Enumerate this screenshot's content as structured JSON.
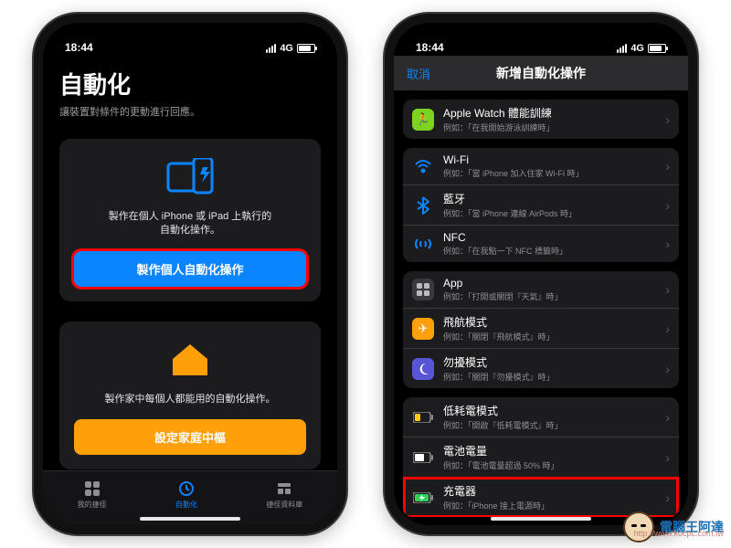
{
  "status": {
    "time": "18:44",
    "carrier": "4G"
  },
  "left": {
    "title": "自動化",
    "subtitle": "讓裝置對條件的更動進行回應。",
    "card1": {
      "desc_line1": "製作在個人 iPhone 或 iPad 上執行的",
      "desc_line2": "自動化操作。",
      "button": "製作個人自動化操作"
    },
    "card2": {
      "desc": "製作家中每個人都能用的自動化操作。",
      "button": "設定家庭中樞"
    },
    "tabs": {
      "t1": "我的捷徑",
      "t2": "自動化",
      "t3": "捷徑資料庫"
    }
  },
  "right": {
    "cancel": "取消",
    "nav_title": "新增自動化操作",
    "rows": {
      "watch": {
        "title": "Apple Watch 體能訓練",
        "sub": "例如：「在我開始游泳訓練時」"
      },
      "wifi": {
        "title": "Wi-Fi",
        "sub": "例如：「當 iPhone 加入住家 Wi-Fi 時」"
      },
      "bt": {
        "title": "藍牙",
        "sub": "例如：「當 iPhone 連線 AirPods 時」"
      },
      "nfc": {
        "title": "NFC",
        "sub": "例如：「在我點一下 NFC 標籤時」"
      },
      "app": {
        "title": "App",
        "sub": "例如：「打開或關閉『天氣』時」"
      },
      "air": {
        "title": "飛航模式",
        "sub": "例如：「關閉『飛航模式』時」"
      },
      "dnd": {
        "title": "勿擾模式",
        "sub": "例如：「關閉『勿擾模式』時」"
      },
      "low": {
        "title": "低耗電模式",
        "sub": "例如：「開啟『低耗電模式』時」"
      },
      "level": {
        "title": "電池電量",
        "sub": "例如：「電池電量超過 50% 時」"
      },
      "charger": {
        "title": "充電器",
        "sub": "例如：「iPhone 接上電源時」"
      }
    }
  },
  "watermark": {
    "text": "電腦王阿達",
    "url": "http://www.kocpc.com.tw"
  }
}
